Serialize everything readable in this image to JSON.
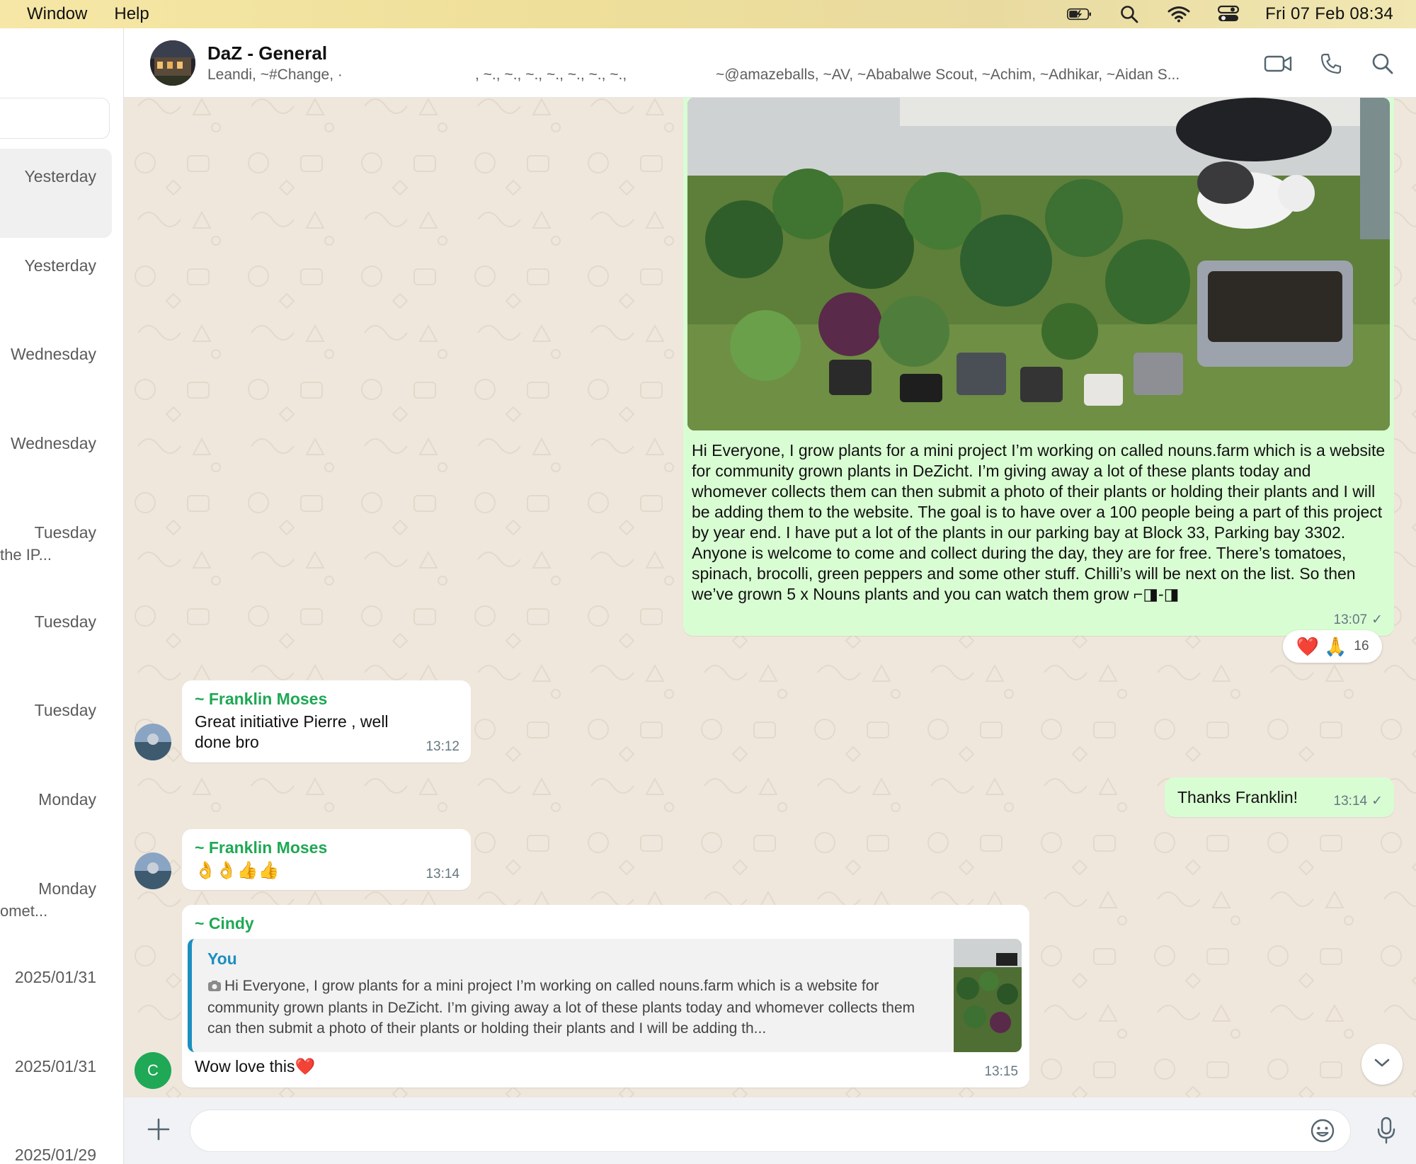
{
  "menubar": {
    "items": [
      "Window",
      "Help"
    ],
    "clock": "Fri 07 Feb  08:34"
  },
  "sidebar": {
    "chats": [
      {
        "time": "Yesterday",
        "snippet": ""
      },
      {
        "time": "Yesterday",
        "snippet": ""
      },
      {
        "time": "Wednesday",
        "snippet": ""
      },
      {
        "time": "Wednesday",
        "snippet": ""
      },
      {
        "time": "Tuesday",
        "snippet": "the IP..."
      },
      {
        "time": "Tuesday",
        "snippet": ""
      },
      {
        "time": "Tuesday",
        "snippet": ""
      },
      {
        "time": "Monday",
        "snippet": ""
      },
      {
        "time": "Monday",
        "snippet": "omet..."
      },
      {
        "time": "2025/01/31",
        "snippet": ""
      },
      {
        "time": "2025/01/31",
        "snippet": ""
      },
      {
        "time": "2025/01/29",
        "snippet": ""
      }
    ]
  },
  "header": {
    "group_name": "DaZ - General",
    "members_part1": "Leandi, ~#Change, ·",
    "members_part2": ", ~., ~., ~., ~., ~., ~., ~.,",
    "members_part3": "~@amazeballs, ~AV, ~Ababalwe Scout, ~Achim, ~Adhikar, ~Aidan S..."
  },
  "messages": {
    "m1": {
      "text": "Hi Everyone, I grow plants for a mini project I’m working on called nouns.farm which is a website for community grown plants in DeZicht. I’m giving away a lot of these plants today and whomever collects them can then submit a photo of their plants or holding their plants and I will be adding them to the website. The goal is to have over a 100 people being a part of this project by year end. I have put a lot of the plants in our parking bay at Block 33, Parking bay 3302. Anyone is welcome to come and collect during the day, they are for free. There’s tomatoes, spinach, brocolli, green peppers and some other stuff. Chilli’s will be next on the list. So then we’ve grown 5 x Nouns plants and you can watch them grow ⌐◨-◨",
      "time": "13:07",
      "tick": "✓",
      "reactions": {
        "emojis": "❤️ 🙏",
        "count": "16"
      }
    },
    "m2": {
      "sender": "~ Franklin Moses",
      "text": "Great initiative Pierre , well done bro",
      "time": "13:12"
    },
    "m3": {
      "text": "Thanks Franklin!",
      "time": "13:14",
      "tick": "✓"
    },
    "m4": {
      "sender": "~ Franklin Moses",
      "text": "👌👌👍👍",
      "time": "13:14"
    },
    "m5": {
      "sender": "~ Cindy",
      "quote_author": "You",
      "quote_text": "Hi Everyone, I grow plants for a mini project I’m working on called nouns.farm which is a website for community grown plants in DeZicht. I’m giving away a lot of these plants today and whomever collects them can then submit a photo of their plants or holding their plants and I will be adding th...",
      "text": "Wow love this❤️",
      "time": "13:15",
      "avatar_initial": "C"
    }
  },
  "composer": {
    "value": "",
    "placeholder": ""
  },
  "colors": {
    "outgoing_bubble": "#d9fdd3",
    "incoming_bubble": "#ffffff",
    "chat_background": "#efe7dc",
    "sender_name": "#1fa855",
    "quote_accent": "#1c8fc0"
  },
  "icons": [
    "battery-charging-icon",
    "spotlight-search-icon",
    "wifi-icon",
    "control-center-icon",
    "video-call-icon",
    "voice-call-icon",
    "search-icon",
    "plus-icon",
    "emoji-icon",
    "microphone-icon",
    "chevron-down-icon",
    "camera-icon"
  ]
}
